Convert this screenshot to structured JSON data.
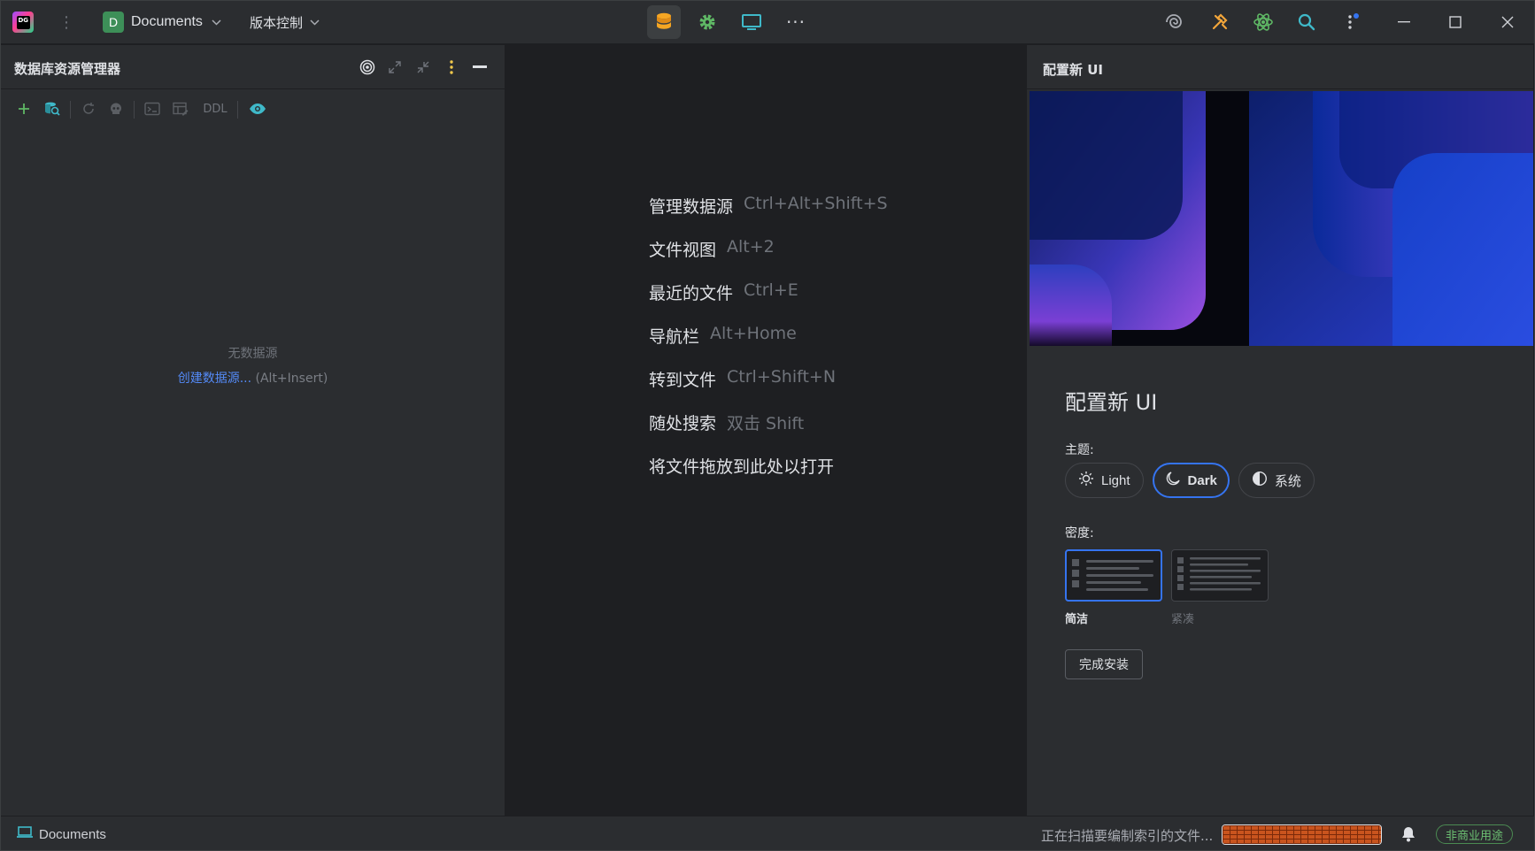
{
  "titlebar": {
    "project_badge": "D",
    "project_name": "Documents",
    "vcs_label": "版本控制",
    "more": "···"
  },
  "left_panel": {
    "title": "数据库资源管理器",
    "ddl": "DDL",
    "empty_text": "无数据源",
    "create_link": "创建数据源...",
    "create_shortcut": " (Alt+Insert)"
  },
  "center": {
    "hints": [
      {
        "label": "管理数据源",
        "key": "Ctrl+Alt+Shift+S"
      },
      {
        "label": "文件视图",
        "key": "Alt+2"
      },
      {
        "label": "最近的文件",
        "key": "Ctrl+E"
      },
      {
        "label": "导航栏",
        "key": "Alt+Home"
      },
      {
        "label": "转到文件",
        "key": "Ctrl+Shift+N"
      },
      {
        "label": "随处搜索",
        "key": "双击 Shift"
      },
      {
        "label": "将文件拖放到此处以打开",
        "key": ""
      }
    ]
  },
  "right_panel": {
    "title": "配置新 UI",
    "heading": "配置新 UI",
    "theme_label": "主题:",
    "themes": [
      {
        "label": "Light",
        "selected": false
      },
      {
        "label": "Dark",
        "selected": true
      },
      {
        "label": "系统",
        "selected": false
      }
    ],
    "density_label": "密度:",
    "densities": [
      {
        "label": "简洁",
        "selected": true
      },
      {
        "label": "紧凑",
        "selected": false
      }
    ],
    "finish_button": "完成安装"
  },
  "statusbar": {
    "project": "Documents",
    "status_text": "正在扫描要编制索引的文件...",
    "license": "非商业用途"
  },
  "colors": {
    "accent": "#3574f0",
    "link": "#548af7",
    "license_green": "#6cbf72",
    "progress_orange": "#c9541e"
  }
}
